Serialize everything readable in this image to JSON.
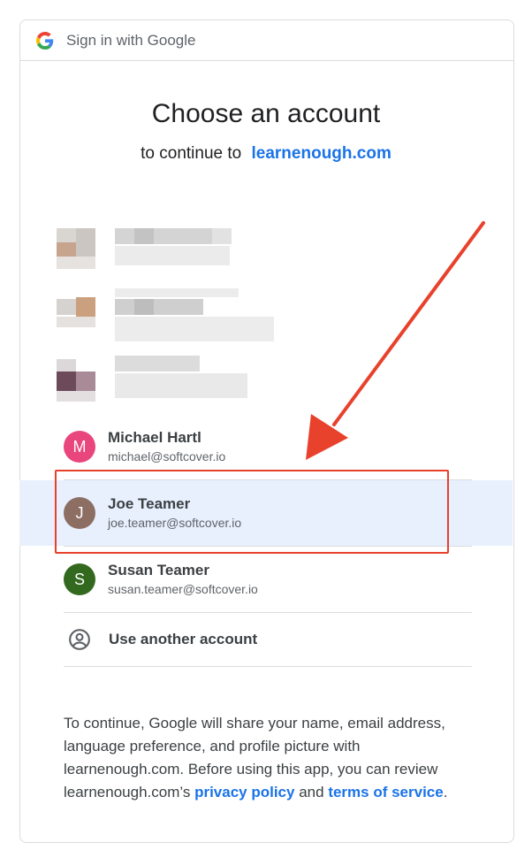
{
  "header": {
    "title": "Sign in with Google"
  },
  "main": {
    "title": "Choose an account",
    "subtitle_prefix": "to continue to",
    "subtitle_link": "learnenough.com"
  },
  "accounts": [
    {
      "initial": "M",
      "name": "Michael Hartl",
      "email": "michael@softcover.io",
      "color": "#e8467c",
      "selected": false
    },
    {
      "initial": "J",
      "name": "Joe Teamer",
      "email": "joe.teamer@softcover.io",
      "color": "#8d6e63",
      "selected": true
    },
    {
      "initial": "S",
      "name": "Susan Teamer",
      "email": "susan.teamer@softcover.io",
      "color": "#33691e",
      "selected": false
    }
  ],
  "another_account": {
    "label": "Use another account",
    "icon": "account-circle-icon"
  },
  "disclaimer": {
    "text": "To continue, Google will share your name, email address, language preference, and profile picture with learnenough.com. Before using this app, you can review learnenough.com’s",
    "privacy_link": "privacy policy",
    "and": "and",
    "terms_link": "terms of service",
    "period": "."
  },
  "colors": {
    "accent": "#1a73e8",
    "selected_bg": "#e8f0fe",
    "annotation_red": "#e8412c"
  }
}
